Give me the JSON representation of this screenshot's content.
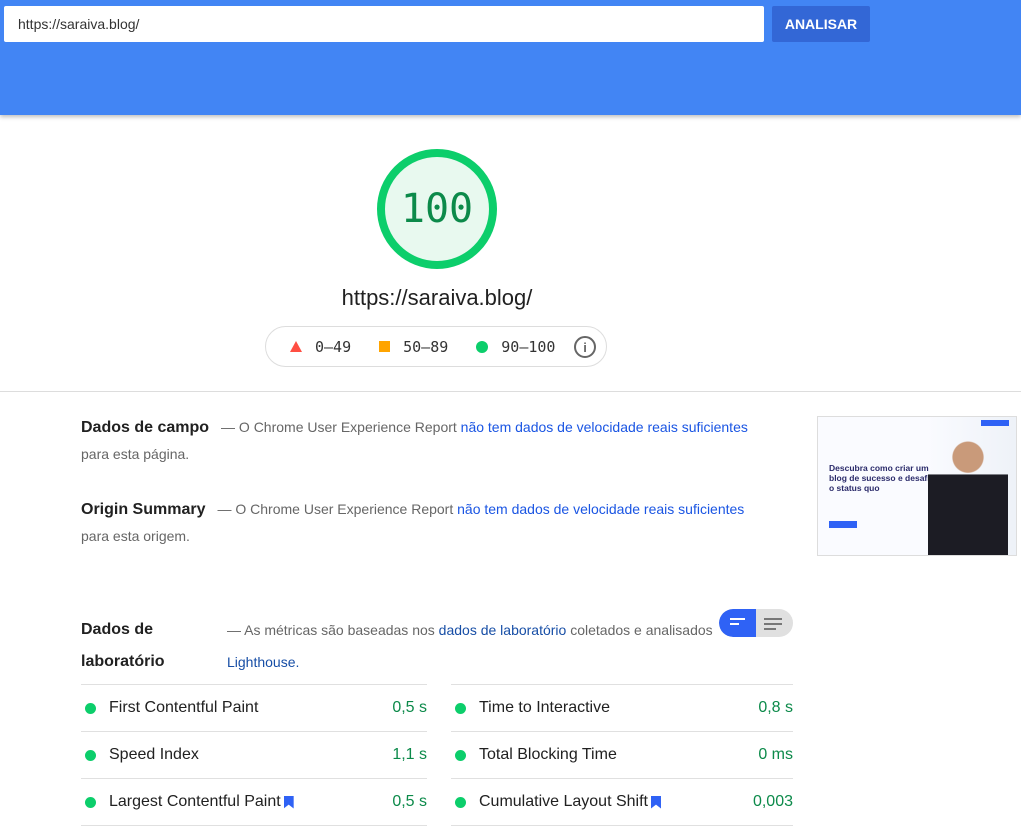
{
  "header": {
    "url_value": "https://saraiva.blog/",
    "analyze_label": "ANALISAR",
    "color": "#4285f4"
  },
  "score": {
    "value": "100",
    "percent": 100,
    "color": "#0cce6b",
    "url": "https://saraiva.blog/"
  },
  "legend": {
    "fail": "0–49",
    "average": "50–89",
    "pass": "90–100",
    "info_icon": "info-icon"
  },
  "field": {
    "title": "Dados de campo",
    "pre": "— O Chrome User Experience Report ",
    "link": "não tem dados de velocidade reais suficientes",
    "post": "para esta página."
  },
  "origin": {
    "title": "Origin Summary",
    "pre": "— O Chrome User Experience Report ",
    "link": "não tem dados de velocidade reais suficientes",
    "post": "para esta origem."
  },
  "thumbnail": {
    "heading": "Descubra como criar um blog de sucesso e desafiar o status quo"
  },
  "lab": {
    "title": "Dados de laboratório",
    "pre": "— As métricas são baseadas nos ",
    "link1": "dados de laboratório",
    "mid": " coletados e analisados ",
    "link2": "Lighthouse.",
    "left": [
      {
        "label": "First Contentful Paint",
        "value": "0,5 s"
      },
      {
        "label": "Speed Index",
        "value": "1,1 s"
      },
      {
        "label": "Largest Contentful Paint",
        "value": "0,5 s",
        "bookmark": true
      }
    ],
    "right": [
      {
        "label": "Time to Interactive",
        "value": "0,8 s"
      },
      {
        "label": "Total Blocking Time",
        "value": "0 ms"
      },
      {
        "label": "Cumulative Layout Shift",
        "value": "0,003",
        "bookmark": true
      }
    ]
  }
}
